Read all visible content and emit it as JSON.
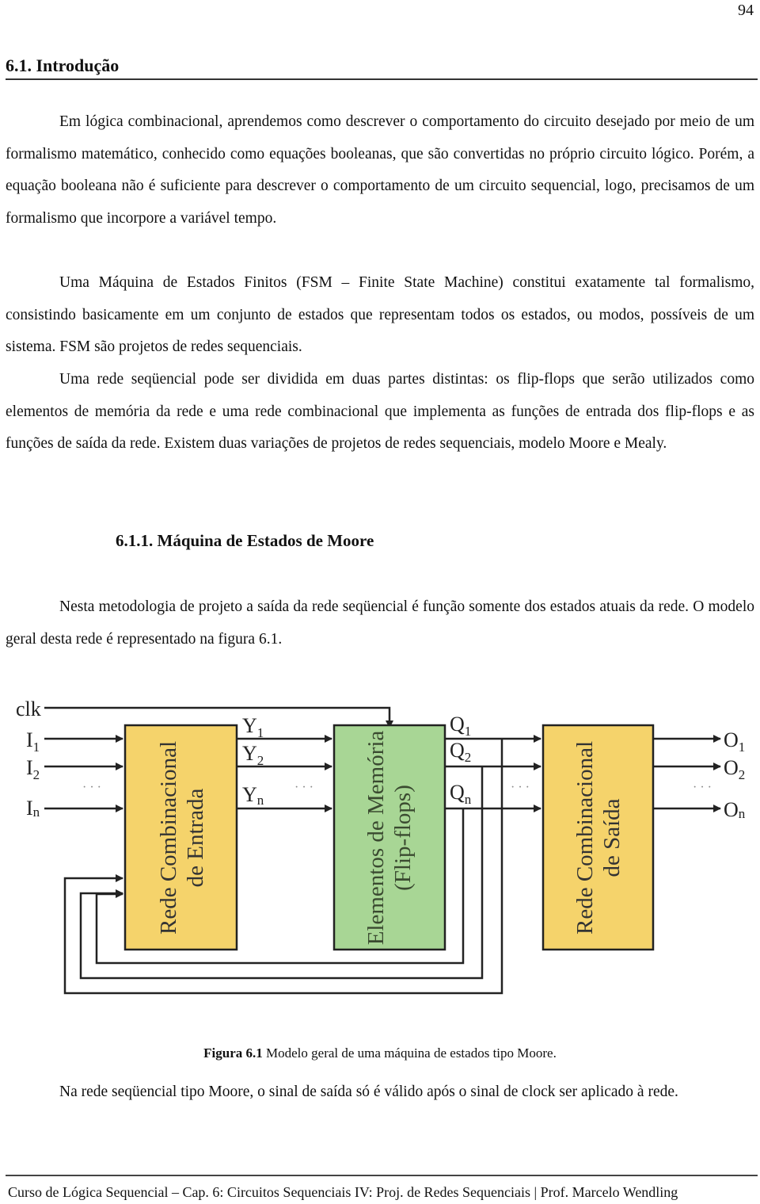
{
  "page_number": "94",
  "section": {
    "title": "6.1. Introdução"
  },
  "paragraphs": [
    "Em lógica combinacional, aprendemos como descrever o comportamento do circuito desejado por meio de um formalismo matemático, conhecido como equações booleanas, que são convertidas no próprio circuito lógico. Porém, a equação booleana não é suficiente para descrever o comportamento de um circuito sequencial, logo, precisamos de um formalismo que incorpore a variável tempo.",
    "Uma Máquina de Estados Finitos (FSM – Finite State Machine) constitui exatamente tal formalismo, consistindo basicamente em um conjunto de estados que representam todos os estados, ou modos, possíveis de um sistema. FSM são projetos de redes sequenciais.",
    "Uma rede seqüencial pode ser dividida em duas partes distintas: os flip-flops que serão utilizados como elementos de memória da rede e uma rede combinacional que implementa as funções de entrada dos flip-flops e as funções de saída da rede. Existem duas variações de projetos de redes sequenciais, modelo Moore e Mealy."
  ],
  "subsection": {
    "title": "6.1.1. Máquina de Estados de Moore",
    "paragraph": "Nesta metodologia de projeto a saída da rede seqüencial é função somente dos estados atuais da rede. O modelo geral desta rede é representado na figura 6.1."
  },
  "figure": {
    "clock_label": "clk",
    "inputs": [
      {
        "base": "I",
        "sub": "1"
      },
      {
        "base": "I",
        "sub": "2"
      },
      {
        "base": "I",
        "sub": "n"
      }
    ],
    "excitations": [
      {
        "base": "Y",
        "sub": "1"
      },
      {
        "base": "Y",
        "sub": "2"
      },
      {
        "base": "Y",
        "sub": "n"
      }
    ],
    "states": [
      {
        "base": "Q",
        "sub": "1"
      },
      {
        "base": "Q",
        "sub": "2"
      },
      {
        "base": "Q",
        "sub": "n"
      }
    ],
    "outputs": [
      {
        "base": "O",
        "sub": "1"
      },
      {
        "base": "O",
        "sub": "2"
      },
      {
        "base": "O",
        "sub": "n"
      }
    ],
    "ellipsis": "· · ·",
    "blocks": {
      "input_logic": {
        "line1": "Rede Combinacional",
        "line2": "de Entrada",
        "color": "#f5d36b"
      },
      "memory": {
        "line1": "Elementos de Memória",
        "line2": "(Flip-flops)",
        "color": "#a8d695"
      },
      "output_logic": {
        "line1": "Rede Combinacional",
        "line2": "de Saída",
        "color": "#f5d36b"
      }
    },
    "caption_label": "Figura 6.1",
    "caption_text": " Modelo geral de uma máquina de estados tipo Moore."
  },
  "closing_paragraph": "Na rede seqüencial tipo Moore, o sinal de saída só é válido após o sinal de clock ser aplicado à rede.",
  "footer": "Curso de Lógica Sequencial – Cap. 6: Circuitos Sequenciais IV: Proj. de Redes Sequenciais  |  Prof. Marcelo Wendling"
}
